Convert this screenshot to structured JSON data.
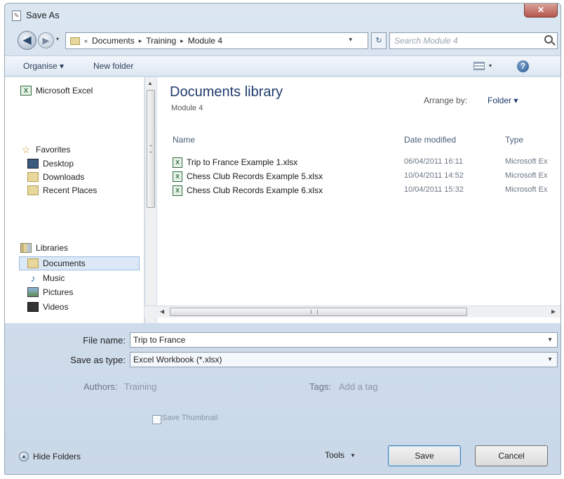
{
  "window": {
    "title": "Save As",
    "close_glyph": "✕"
  },
  "nav": {
    "back_glyph": "◀",
    "forward_glyph": "▶",
    "dropdown_glyph": "▾",
    "breadcrumb": [
      "Documents",
      "Training",
      "Module 4"
    ],
    "prefix_glyph": "«",
    "separator_glyph": "▸",
    "refresh_glyph": "↻",
    "search_placeholder": "Search Module 4"
  },
  "toolbar": {
    "organize_label": "Organise ▾",
    "new_folder_label": "New folder",
    "views_dropdown_glyph": "▾",
    "help_glyph": "?"
  },
  "sidebar": {
    "top_item": "Microsoft Excel",
    "favorites_header": "Favorites",
    "favorites": [
      "Desktop",
      "Downloads",
      "Recent Places"
    ],
    "libraries_header": "Libraries",
    "libraries": [
      "Documents",
      "Music",
      "Pictures",
      "Videos"
    ],
    "selected": "Documents"
  },
  "library": {
    "title": "Documents library",
    "subtitle": "Module 4",
    "arrange_label": "Arrange by:",
    "arrange_value": "Folder ▾",
    "columns": {
      "name": "Name",
      "date": "Date modified",
      "type": "Type"
    },
    "files": [
      {
        "name": "Trip to France Example 1.xlsx",
        "date": "06/04/2011 16:11",
        "type": "Microsoft Ex"
      },
      {
        "name": "Chess Club Records Example 5.xlsx",
        "date": "10/04/2011 14:52",
        "type": "Microsoft Ex"
      },
      {
        "name": "Chess Club Records Example 6.xlsx",
        "date": "10/04/2011 15:32",
        "type": "Microsoft Ex"
      }
    ]
  },
  "form": {
    "filename_label": "File name:",
    "filename_value": "Trip to France",
    "savetype_label": "Save as type:",
    "savetype_value": "Excel Workbook (*.xlsx)",
    "authors_label": "Authors:",
    "authors_value": "Training",
    "tags_label": "Tags:",
    "tags_value": "Add a tag",
    "thumbnail_label": "Save Thumbnail"
  },
  "footer": {
    "hide_folders_label": "Hide Folders",
    "tools_label": "Tools",
    "save_label": "Save",
    "cancel_label": "Cancel"
  },
  "colors": {
    "accent": "#1e3a6b",
    "selection": "#dce8f6"
  }
}
